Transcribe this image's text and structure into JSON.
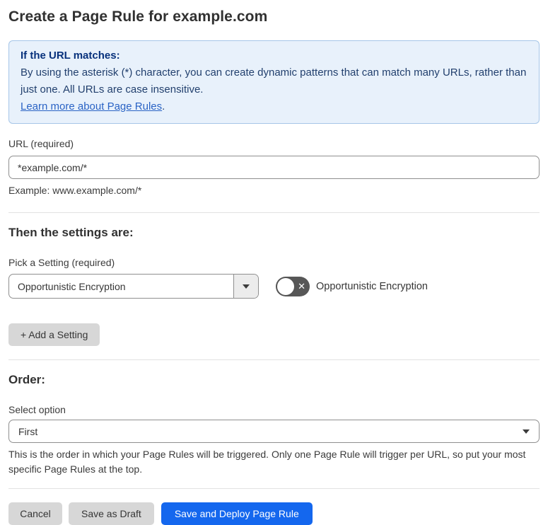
{
  "page": {
    "title": "Create a Page Rule for example.com"
  },
  "info_box": {
    "heading": "If the URL matches:",
    "body": "By using the asterisk (*) character, you can create dynamic patterns that can match many URLs, rather than just one. All URLs are case insensitive.",
    "link_label": "Learn more about Page Rules",
    "link_suffix": "."
  },
  "url_field": {
    "label": "URL (required)",
    "value": "*example.com/*",
    "helper": "Example: www.example.com/*"
  },
  "settings_section": {
    "heading": "Then the settings are:",
    "picker_label": "Pick a Setting (required)",
    "picker_value": "Opportunistic Encryption",
    "picker_icon": "caret-down-icon",
    "toggle_state": "off",
    "toggle_icon": "x-mark",
    "toggle_glyph": "✕",
    "toggle_caption": "Opportunistic Encryption",
    "add_button_label": "+ Add a Setting"
  },
  "order_section": {
    "heading": "Order:",
    "select_label": "Select option",
    "select_value": "First",
    "select_icon": "caret-down-icon",
    "helper": "This is the order in which your Page Rules will be triggered. Only one Page Rule will trigger per URL, so put your most specific Page Rules at the top."
  },
  "actions": {
    "cancel_label": "Cancel",
    "save_draft_label": "Save as Draft",
    "save_deploy_label": "Save and Deploy Page Rule"
  },
  "colors": {
    "primary_button_blue": "#1467ee",
    "info_box_background": "#e8f1fb",
    "info_box_border": "#a6c6e8",
    "info_box_text": "#22406e",
    "info_box_heading": "#07317c",
    "link_blue": "#2a63c5",
    "toggle_off_background": "#575757",
    "secondary_button_gray": "#d7d7d7",
    "input_border": "#8f8f8f",
    "body_text": "#363636"
  }
}
